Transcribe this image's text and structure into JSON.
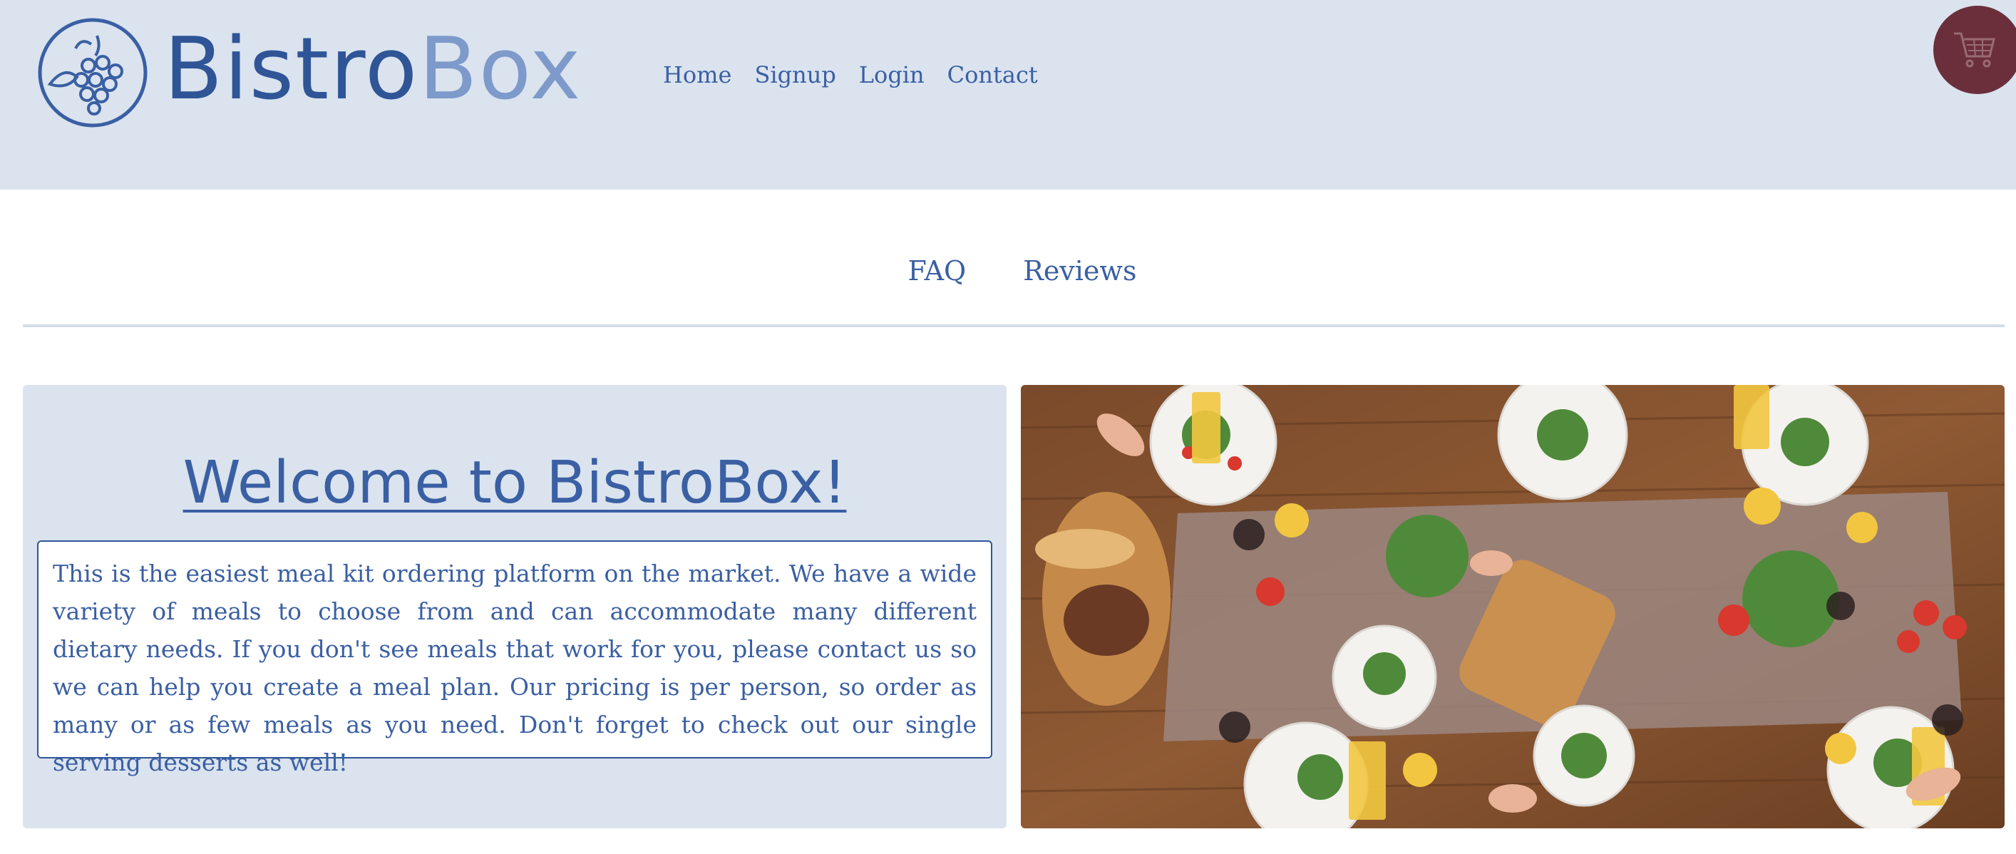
{
  "brand": {
    "name_part1": "Bistro",
    "name_part2": "Box",
    "logo_icon": "grapes-circle-icon"
  },
  "nav": {
    "items": [
      {
        "label": "Home"
      },
      {
        "label": "Signup"
      },
      {
        "label": "Login"
      },
      {
        "label": "Contact"
      }
    ]
  },
  "cart": {
    "icon": "shopping-cart-icon"
  },
  "subnav": {
    "items": [
      {
        "label": "FAQ"
      },
      {
        "label": "Reviews"
      }
    ]
  },
  "welcome": {
    "title": "Welcome to BistroBox!",
    "description": "This is the easiest meal kit ordering platform on the market. We have a wide variety of meals to choose from and can accommodate many different dietary needs. If you don't see meals that work for you, please contact us so we can help you create a meal plan. Our pricing is per person, so order as many or as few meals as you need. Don't forget to check out our single serving desserts as well!"
  },
  "colors": {
    "header_bg": "#dae3ee",
    "primary": "#2f5597",
    "accent_light": "#7e9acb",
    "cart_bg": "#6b2f3c",
    "card_bg": "#dae3ee"
  }
}
